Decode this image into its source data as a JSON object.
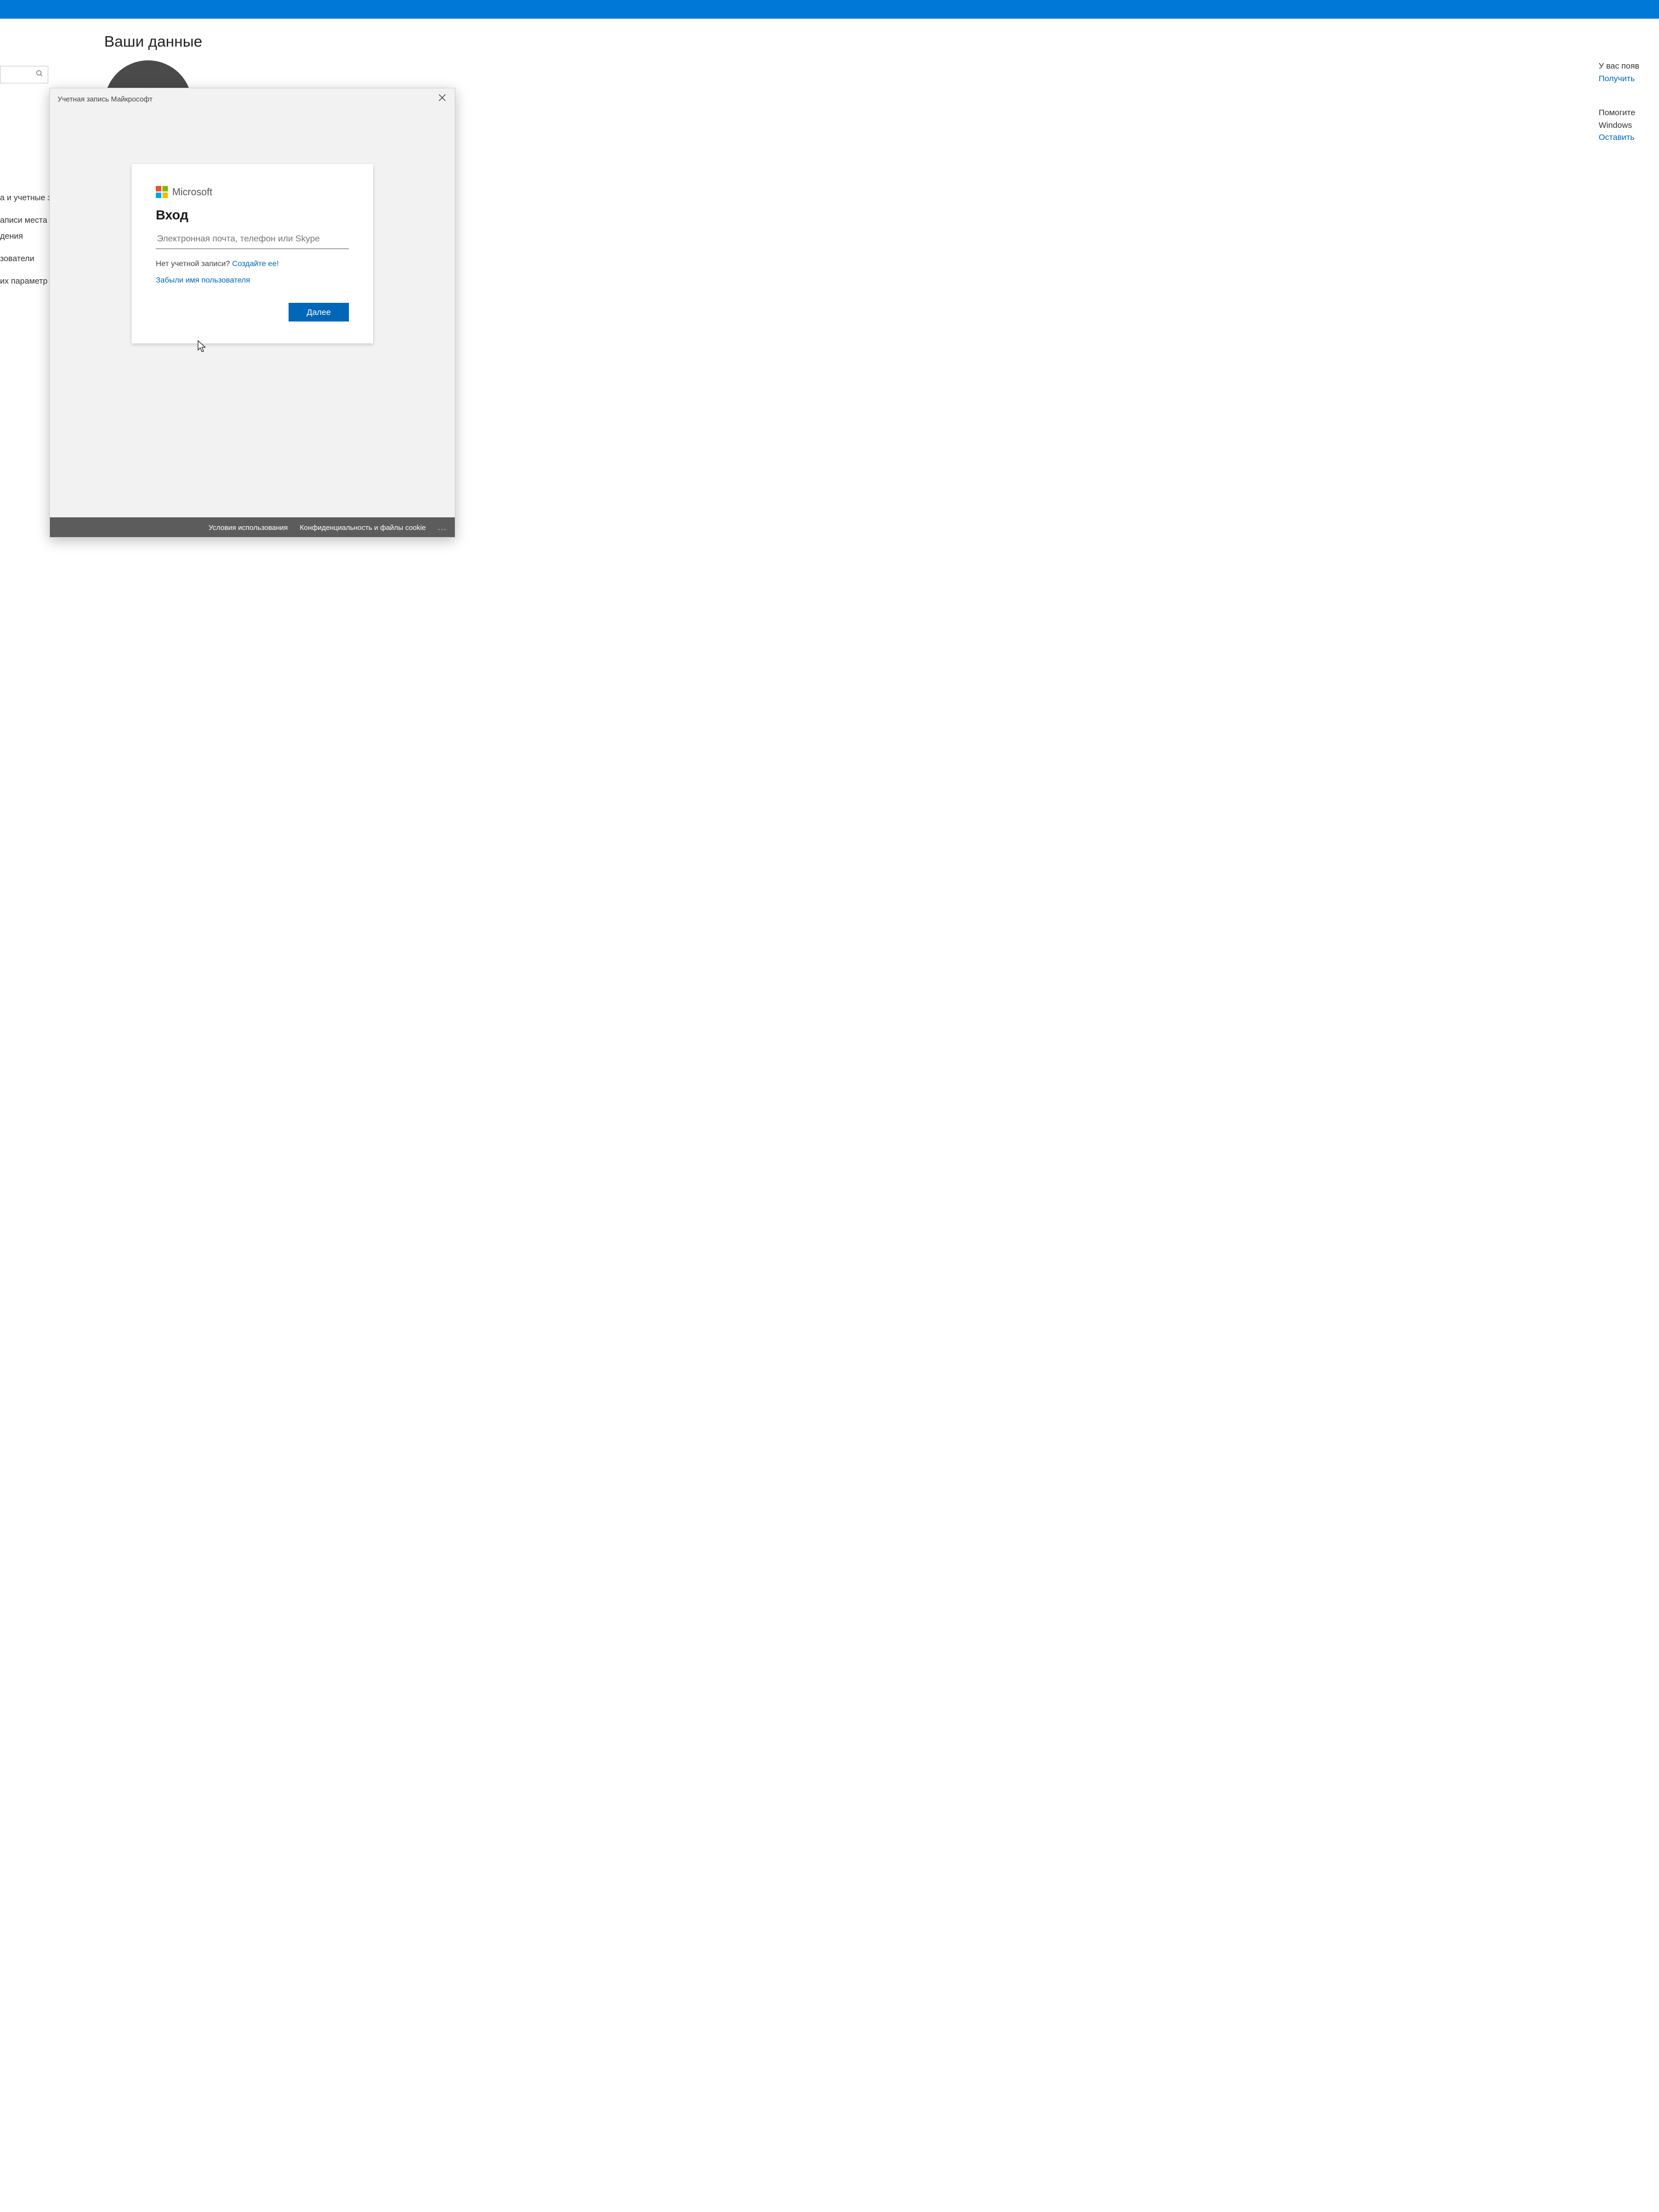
{
  "settings": {
    "page_title": "Ваши данные",
    "search_placeholder": ""
  },
  "sidebar": {
    "items": [
      "а и учетные за",
      "аписи места р",
      "дения",
      "зователи",
      "их параметр"
    ]
  },
  "right_pane": {
    "line1": "У вас появ",
    "link1": "Получить",
    "line2a": "Помогите",
    "line2b": "Windows",
    "link2": "Оставить"
  },
  "dialog": {
    "title": "Учетная запись Майкрософт",
    "footer_terms": "Условия использования",
    "footer_privacy": "Конфиденциальность и файлы cookie",
    "footer_more": "..."
  },
  "signin": {
    "brand": "Microsoft",
    "heading": "Вход",
    "input_placeholder": "Электронная почта, телефон или Skype",
    "no_account_text": "Нет учетной записи? ",
    "create_link": "Создайте ее!",
    "forgot_username": "Забыли имя пользователя",
    "next_button": "Далее"
  }
}
